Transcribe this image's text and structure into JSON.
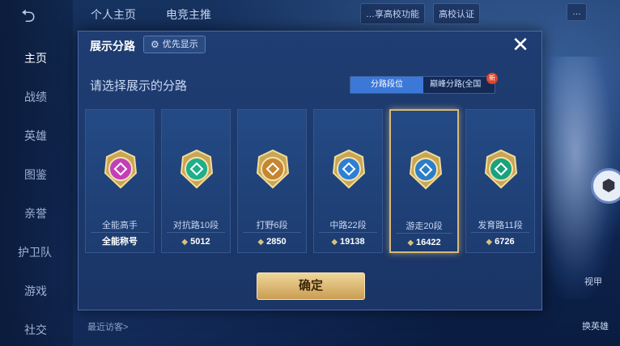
{
  "top_tabs": [
    "个人主页",
    "电竞主推"
  ],
  "top_right": {
    "school_tip": "…享高校功能",
    "school_cert": "高校认证",
    "extra": "…"
  },
  "nav": [
    "主页",
    "战绩",
    "英雄",
    "图鉴",
    "亲誉",
    "护卫队",
    "游戏",
    "社交"
  ],
  "right_labels": [
    "视甲",
    "换英雄"
  ],
  "recent_visitors": "最近访客>",
  "dialog": {
    "title": "展示分路",
    "priority_label": "优先显示",
    "close_symbol": "✕",
    "subtitle": "请选择展示的分路",
    "segment": {
      "active": "分路段位",
      "inactive": "巅峰分路(全国",
      "badge": "新"
    },
    "confirm_label": "确定",
    "cards": [
      {
        "name": "全能高手",
        "value": "全能称号",
        "icon": "all-round-emblem-icon",
        "color": "#c23fb8",
        "has_star": false,
        "selected": false
      },
      {
        "name": "对抗路10段",
        "value": "5012",
        "icon": "clash-lane-emblem-icon",
        "color": "#1fae8a",
        "has_star": true,
        "selected": false
      },
      {
        "name": "打野6段",
        "value": "2850",
        "icon": "jungle-emblem-icon",
        "color": "#c6862f",
        "has_star": true,
        "selected": false
      },
      {
        "name": "中路22段",
        "value": "19138",
        "icon": "mid-lane-emblem-icon",
        "color": "#2d7fd6",
        "has_star": true,
        "selected": false
      },
      {
        "name": "游走20段",
        "value": "16422",
        "icon": "roam-emblem-icon",
        "color": "#2a7ec9",
        "has_star": true,
        "selected": true
      },
      {
        "name": "发育路11段",
        "value": "6726",
        "icon": "farm-lane-emblem-icon",
        "color": "#1aa27e",
        "has_star": true,
        "selected": false
      }
    ]
  },
  "colors": {
    "accent": "#3b78d8",
    "gold": "#d8b978",
    "panel": "#1f3d72"
  }
}
